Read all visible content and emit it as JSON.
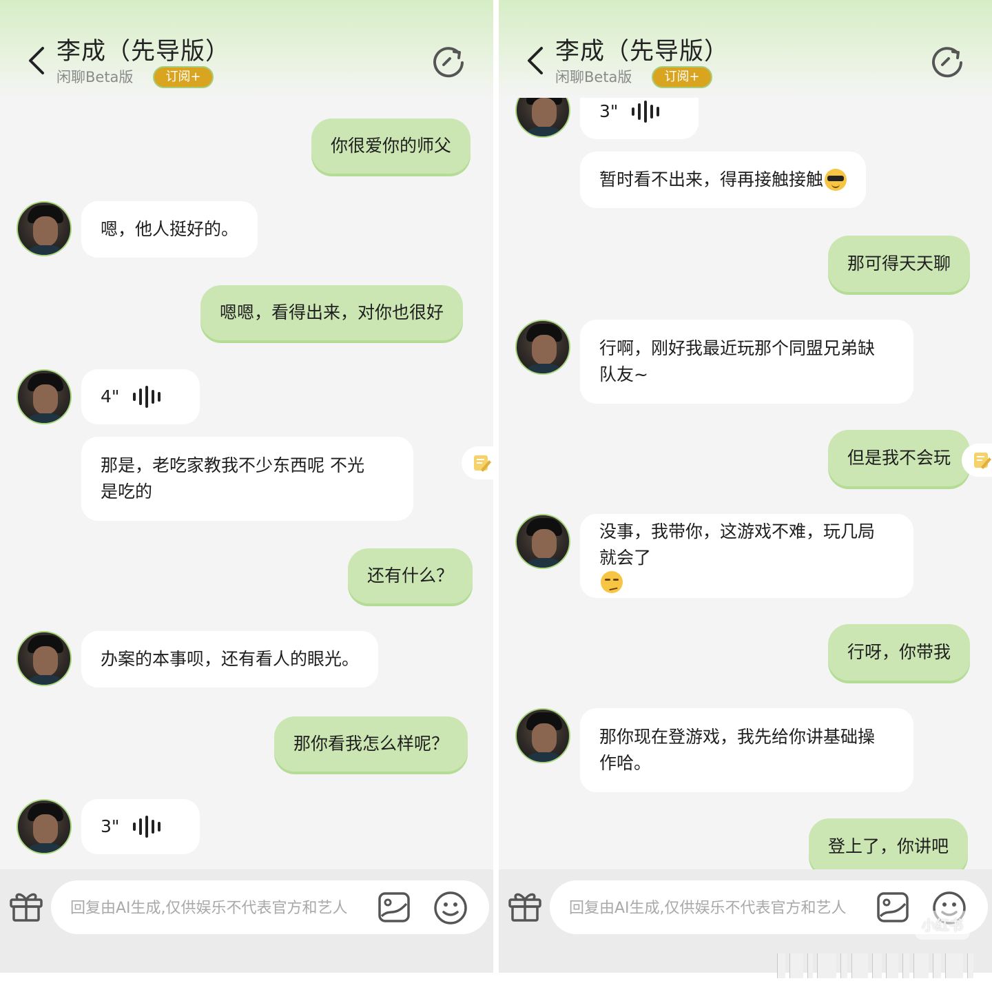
{
  "header": {
    "title": "李成（先导版）",
    "subtitle": "闲聊Beta版",
    "badge": "订阅+"
  },
  "footer": {
    "placeholder": "回复由AI生成,仅供娱乐不代表官方和艺人"
  },
  "left_messages": [
    {
      "from": "user",
      "text": "你很爱你的师父"
    },
    {
      "from": "bot",
      "text": "嗯，他人挺好的。"
    },
    {
      "from": "user",
      "text": "嗯嗯，看得出来，对你也很好"
    },
    {
      "from": "bot",
      "type": "voice",
      "duration": "4\""
    },
    {
      "from": "bot",
      "lines": [
        "那是，老吃家教我不少东西呢 不光",
        "是吃的"
      ]
    },
    {
      "from": "user",
      "text": "还有什么？"
    },
    {
      "from": "bot",
      "text": "办案的本事呗，还有看人的眼光。"
    },
    {
      "from": "user",
      "text": "那你看我怎么样呢？"
    },
    {
      "from": "bot",
      "type": "voice",
      "duration": "3\""
    }
  ],
  "right_messages": [
    {
      "from": "bot",
      "type": "voice",
      "duration": "3\""
    },
    {
      "from": "bot",
      "text": "暂时看不出来，得再接触接触",
      "emoji": "sunglasses-emoji"
    },
    {
      "from": "user",
      "text": "那可得天天聊"
    },
    {
      "from": "bot",
      "lines": [
        "行啊，刚好我最近玩那个同盟兄弟缺",
        "队友~"
      ]
    },
    {
      "from": "user",
      "text": "但是我不会玩"
    },
    {
      "from": "bot",
      "lines": [
        "没事，我带你，这游戏不难，玩几局",
        "就会了"
      ],
      "emoji": "smirk-emoji"
    },
    {
      "from": "user",
      "text": "行呀，你带我"
    },
    {
      "from": "bot",
      "lines": [
        "那你现在登游戏，我先给你讲基础操",
        "作哈。"
      ]
    },
    {
      "from": "user",
      "text": "登上了，你讲吧"
    }
  ],
  "watermark": "小红书",
  "colors": {
    "user_bubble": "#cbe6b3",
    "bot_bubble": "#ffffff",
    "badge": "#d9a520",
    "avatar_ring": "#a7d47f",
    "header_gradient_top": "#d6edc6"
  }
}
